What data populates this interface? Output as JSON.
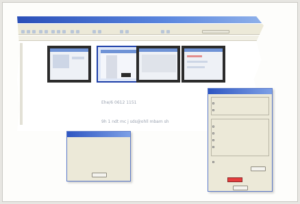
{
  "app": {
    "title": "",
    "menu": [
      "",
      "",
      "",
      "",
      "",
      "",
      "",
      "",
      "",
      "",
      "",
      ""
    ],
    "phone_line": "Ehe/6 0612 1151",
    "email_line": "9h 1 ndt mc j sds@ohll mbam sh"
  },
  "thumbnails": [
    "thumb-1",
    "thumb-2",
    "thumb-3",
    "thumb-4"
  ],
  "dialog_small": {
    "title": "",
    "rows": [
      "",
      "",
      "",
      ""
    ],
    "ok_label": ""
  },
  "dialog_right": {
    "title": "",
    "ok_label": ""
  },
  "colors": {
    "titlebar": "#2a4fb8",
    "selection": "#1c3ea8",
    "swatch": "#e53d3d"
  }
}
